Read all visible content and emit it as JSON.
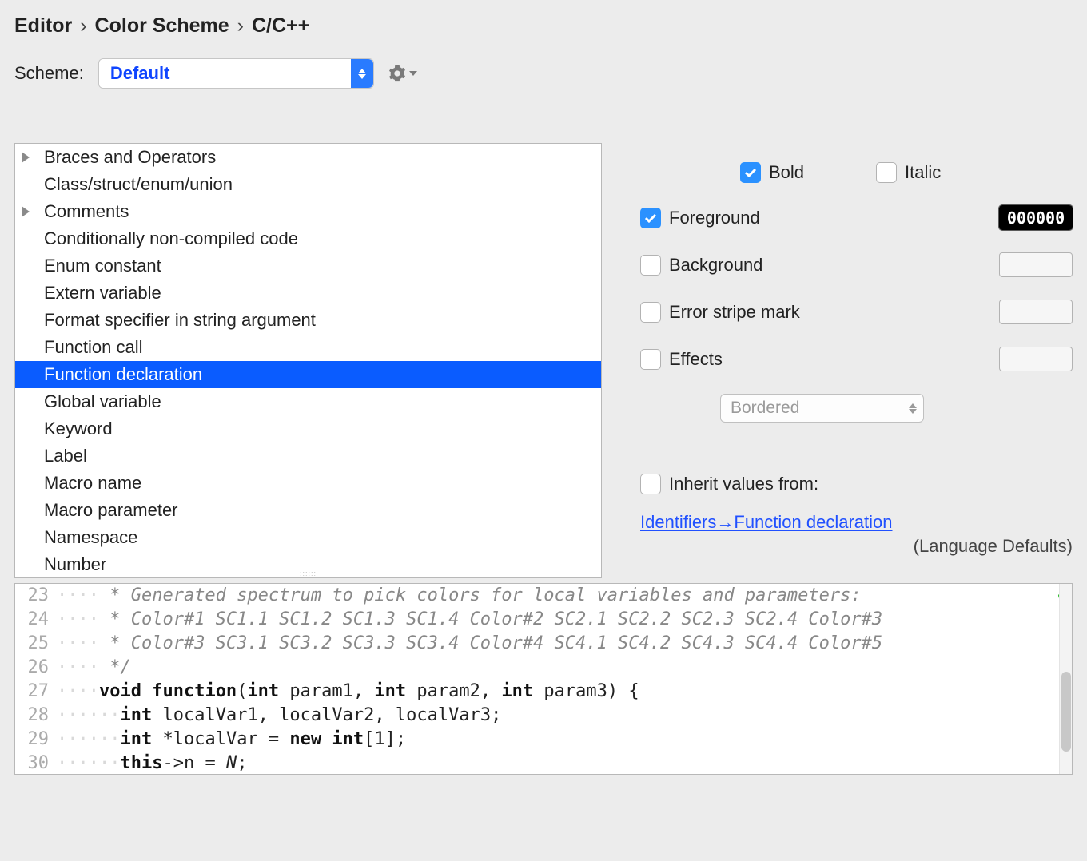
{
  "breadcrumb": [
    "Editor",
    "Color Scheme",
    "C/C++"
  ],
  "scheme": {
    "label": "Scheme:",
    "selected": "Default"
  },
  "tree": {
    "items": [
      {
        "label": "Braces and Operators",
        "expandable": true
      },
      {
        "label": "Class/struct/enum/union",
        "expandable": false
      },
      {
        "label": "Comments",
        "expandable": true
      },
      {
        "label": "Conditionally non-compiled code",
        "expandable": false
      },
      {
        "label": "Enum constant",
        "expandable": false
      },
      {
        "label": "Extern variable",
        "expandable": false
      },
      {
        "label": "Format specifier in string argument",
        "expandable": false
      },
      {
        "label": "Function call",
        "expandable": false
      },
      {
        "label": "Function declaration",
        "expandable": false,
        "selected": true
      },
      {
        "label": "Global variable",
        "expandable": false
      },
      {
        "label": "Keyword",
        "expandable": false
      },
      {
        "label": "Label",
        "expandable": false
      },
      {
        "label": "Macro name",
        "expandable": false
      },
      {
        "label": "Macro parameter",
        "expandable": false
      },
      {
        "label": "Namespace",
        "expandable": false
      },
      {
        "label": "Number",
        "expandable": false
      }
    ]
  },
  "props": {
    "bold": {
      "label": "Bold",
      "checked": true
    },
    "italic": {
      "label": "Italic",
      "checked": false
    },
    "foreground": {
      "label": "Foreground",
      "checked": true,
      "value": "000000"
    },
    "background": {
      "label": "Background",
      "checked": false
    },
    "errorstripe": {
      "label": "Error stripe mark",
      "checked": false
    },
    "effects": {
      "label": "Effects",
      "checked": false,
      "selected": "Bordered"
    },
    "inherit": {
      "label": "Inherit values from:",
      "checked": false
    },
    "inherit_link": "Identifiers→Function declaration",
    "inherit_sub": "(Language Defaults)"
  },
  "editor": {
    "lines": [
      {
        "num": 23,
        "ws": "····",
        "pre": "",
        "rest": " * Generated spectrum to pick colors for local variables and parameters:",
        "comment": true
      },
      {
        "num": 24,
        "ws": "····",
        "pre": "",
        "rest": " * Color#1 SC1.1 SC1.2 SC1.3 SC1.4 Color#2 SC2.1 SC2.2 SC2.3 SC2.4 Color#3",
        "comment": true
      },
      {
        "num": 25,
        "ws": "····",
        "pre": "",
        "rest": " * Color#3 SC3.1 SC3.2 SC3.3 SC3.4 Color#4 SC4.1 SC4.2 SC4.3 SC4.4 Color#5",
        "comment": true
      },
      {
        "num": 26,
        "ws": "····",
        "pre": "",
        "rest": " */",
        "comment": true
      },
      {
        "num": 27,
        "ws": "····",
        "html": "<span class=\"kw\">void</span> <span class=\"fn\">function</span>(<span class=\"kw\">int</span> param1, <span class=\"kw\">int</span> param2, <span class=\"kw\">int</span> param3) {"
      },
      {
        "num": 28,
        "ws": "······",
        "html": "<span class=\"kw\">int</span> localVar1, localVar2, localVar3;"
      },
      {
        "num": 29,
        "ws": "······",
        "html": "<span class=\"kw\">int</span> *localVar = <span class=\"kw\">new</span> <span class=\"kw\">int</span>[1];"
      },
      {
        "num": 30,
        "ws": "······",
        "html": "<span class=\"kw\">this</span>->n = <span class=\"it\">N</span>;"
      }
    ]
  }
}
